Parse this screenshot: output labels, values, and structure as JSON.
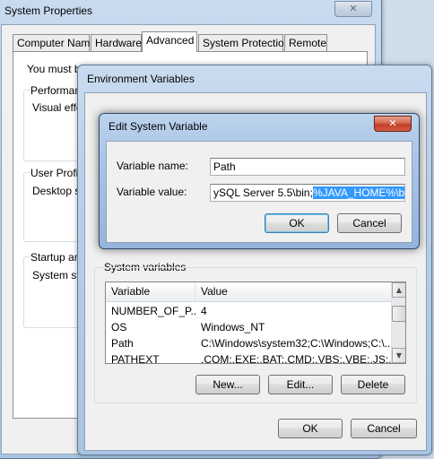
{
  "system_properties": {
    "title": "System Properties",
    "close_label": "✕",
    "tabs": [
      {
        "label": "Computer Name"
      },
      {
        "label": "Hardware"
      },
      {
        "label": "Advanced"
      },
      {
        "label": "System Protection"
      },
      {
        "label": "Remote"
      }
    ],
    "must_be_text": "You must be",
    "groups": [
      {
        "label": "Performanc",
        "body": "Visual effec"
      },
      {
        "label": "User Profile",
        "body": "Desktop se"
      },
      {
        "label": "Startup and",
        "body": "System star"
      }
    ]
  },
  "environment_variables": {
    "title": "Environment Variables",
    "system_section_label": "System variables",
    "columns": {
      "variable": "Variable",
      "value": "Value"
    },
    "rows": [
      {
        "variable": "NUMBER_OF_P...",
        "value": "4"
      },
      {
        "variable": "OS",
        "value": "Windows_NT"
      },
      {
        "variable": "Path",
        "value": "C:\\Windows\\system32;C:\\Windows;C:\\..."
      },
      {
        "variable": "PATHEXT",
        "value": ".COM;.EXE;.BAT;.CMD;.VBS;.VBE;.JS;..."
      }
    ],
    "buttons": {
      "new": "New...",
      "edit": "Edit...",
      "delete": "Delete",
      "ok": "OK",
      "cancel": "Cancel"
    }
  },
  "edit_system_variable": {
    "title": "Edit System Variable",
    "close_label": "✕",
    "name_label": "Variable name:",
    "name_value": "Path",
    "value_label": "Variable value:",
    "value_unselected": "ySQL Server 5.5\\bin;",
    "value_selected": "%JAVA_HOME%\\bin;",
    "buttons": {
      "ok": "OK",
      "cancel": "Cancel"
    }
  }
}
